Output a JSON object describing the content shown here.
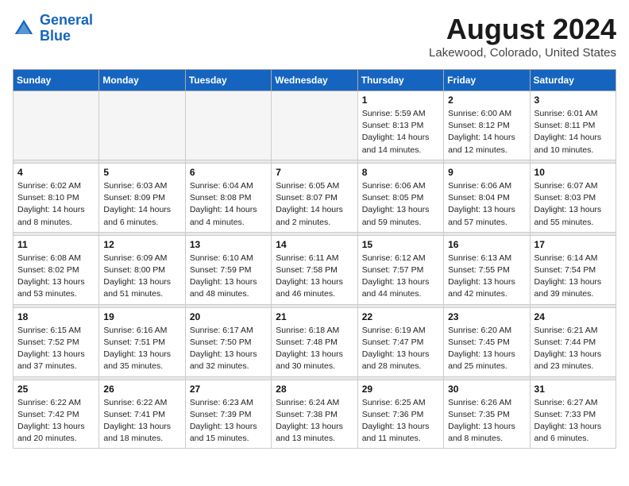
{
  "header": {
    "logo_line1": "General",
    "logo_line2": "Blue",
    "month": "August 2024",
    "location": "Lakewood, Colorado, United States"
  },
  "weekdays": [
    "Sunday",
    "Monday",
    "Tuesday",
    "Wednesday",
    "Thursday",
    "Friday",
    "Saturday"
  ],
  "weeks": [
    [
      {
        "day": "",
        "info": ""
      },
      {
        "day": "",
        "info": ""
      },
      {
        "day": "",
        "info": ""
      },
      {
        "day": "",
        "info": ""
      },
      {
        "day": "1",
        "info": "Sunrise: 5:59 AM\nSunset: 8:13 PM\nDaylight: 14 hours\nand 14 minutes."
      },
      {
        "day": "2",
        "info": "Sunrise: 6:00 AM\nSunset: 8:12 PM\nDaylight: 14 hours\nand 12 minutes."
      },
      {
        "day": "3",
        "info": "Sunrise: 6:01 AM\nSunset: 8:11 PM\nDaylight: 14 hours\nand 10 minutes."
      }
    ],
    [
      {
        "day": "4",
        "info": "Sunrise: 6:02 AM\nSunset: 8:10 PM\nDaylight: 14 hours\nand 8 minutes."
      },
      {
        "day": "5",
        "info": "Sunrise: 6:03 AM\nSunset: 8:09 PM\nDaylight: 14 hours\nand 6 minutes."
      },
      {
        "day": "6",
        "info": "Sunrise: 6:04 AM\nSunset: 8:08 PM\nDaylight: 14 hours\nand 4 minutes."
      },
      {
        "day": "7",
        "info": "Sunrise: 6:05 AM\nSunset: 8:07 PM\nDaylight: 14 hours\nand 2 minutes."
      },
      {
        "day": "8",
        "info": "Sunrise: 6:06 AM\nSunset: 8:05 PM\nDaylight: 13 hours\nand 59 minutes."
      },
      {
        "day": "9",
        "info": "Sunrise: 6:06 AM\nSunset: 8:04 PM\nDaylight: 13 hours\nand 57 minutes."
      },
      {
        "day": "10",
        "info": "Sunrise: 6:07 AM\nSunset: 8:03 PM\nDaylight: 13 hours\nand 55 minutes."
      }
    ],
    [
      {
        "day": "11",
        "info": "Sunrise: 6:08 AM\nSunset: 8:02 PM\nDaylight: 13 hours\nand 53 minutes."
      },
      {
        "day": "12",
        "info": "Sunrise: 6:09 AM\nSunset: 8:00 PM\nDaylight: 13 hours\nand 51 minutes."
      },
      {
        "day": "13",
        "info": "Sunrise: 6:10 AM\nSunset: 7:59 PM\nDaylight: 13 hours\nand 48 minutes."
      },
      {
        "day": "14",
        "info": "Sunrise: 6:11 AM\nSunset: 7:58 PM\nDaylight: 13 hours\nand 46 minutes."
      },
      {
        "day": "15",
        "info": "Sunrise: 6:12 AM\nSunset: 7:57 PM\nDaylight: 13 hours\nand 44 minutes."
      },
      {
        "day": "16",
        "info": "Sunrise: 6:13 AM\nSunset: 7:55 PM\nDaylight: 13 hours\nand 42 minutes."
      },
      {
        "day": "17",
        "info": "Sunrise: 6:14 AM\nSunset: 7:54 PM\nDaylight: 13 hours\nand 39 minutes."
      }
    ],
    [
      {
        "day": "18",
        "info": "Sunrise: 6:15 AM\nSunset: 7:52 PM\nDaylight: 13 hours\nand 37 minutes."
      },
      {
        "day": "19",
        "info": "Sunrise: 6:16 AM\nSunset: 7:51 PM\nDaylight: 13 hours\nand 35 minutes."
      },
      {
        "day": "20",
        "info": "Sunrise: 6:17 AM\nSunset: 7:50 PM\nDaylight: 13 hours\nand 32 minutes."
      },
      {
        "day": "21",
        "info": "Sunrise: 6:18 AM\nSunset: 7:48 PM\nDaylight: 13 hours\nand 30 minutes."
      },
      {
        "day": "22",
        "info": "Sunrise: 6:19 AM\nSunset: 7:47 PM\nDaylight: 13 hours\nand 28 minutes."
      },
      {
        "day": "23",
        "info": "Sunrise: 6:20 AM\nSunset: 7:45 PM\nDaylight: 13 hours\nand 25 minutes."
      },
      {
        "day": "24",
        "info": "Sunrise: 6:21 AM\nSunset: 7:44 PM\nDaylight: 13 hours\nand 23 minutes."
      }
    ],
    [
      {
        "day": "25",
        "info": "Sunrise: 6:22 AM\nSunset: 7:42 PM\nDaylight: 13 hours\nand 20 minutes."
      },
      {
        "day": "26",
        "info": "Sunrise: 6:22 AM\nSunset: 7:41 PM\nDaylight: 13 hours\nand 18 minutes."
      },
      {
        "day": "27",
        "info": "Sunrise: 6:23 AM\nSunset: 7:39 PM\nDaylight: 13 hours\nand 15 minutes."
      },
      {
        "day": "28",
        "info": "Sunrise: 6:24 AM\nSunset: 7:38 PM\nDaylight: 13 hours\nand 13 minutes."
      },
      {
        "day": "29",
        "info": "Sunrise: 6:25 AM\nSunset: 7:36 PM\nDaylight: 13 hours\nand 11 minutes."
      },
      {
        "day": "30",
        "info": "Sunrise: 6:26 AM\nSunset: 7:35 PM\nDaylight: 13 hours\nand 8 minutes."
      },
      {
        "day": "31",
        "info": "Sunrise: 6:27 AM\nSunset: 7:33 PM\nDaylight: 13 hours\nand 6 minutes."
      }
    ]
  ]
}
